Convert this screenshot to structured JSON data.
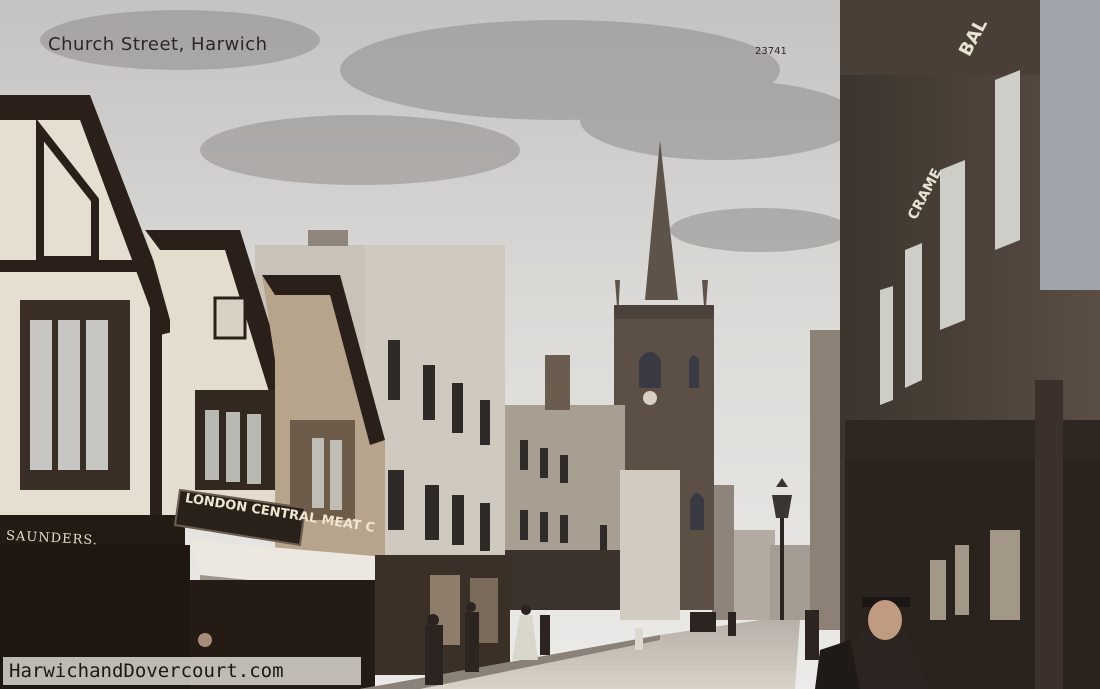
{
  "caption": "Church Street, Harwich",
  "card_number": "23741",
  "watermark": "HarwichandDovercourt.com",
  "signs": {
    "london": "LONDON CENTRAL MEAT C",
    "saunders": "SAUNDERS.",
    "bal": "BAL",
    "cram": "CRAME"
  },
  "colors": {
    "sky": "#dcdcda",
    "cloud": "#9a9896",
    "stone": "#8a7f78",
    "timber": "#2a1f19",
    "road": "#c9c3ba"
  }
}
